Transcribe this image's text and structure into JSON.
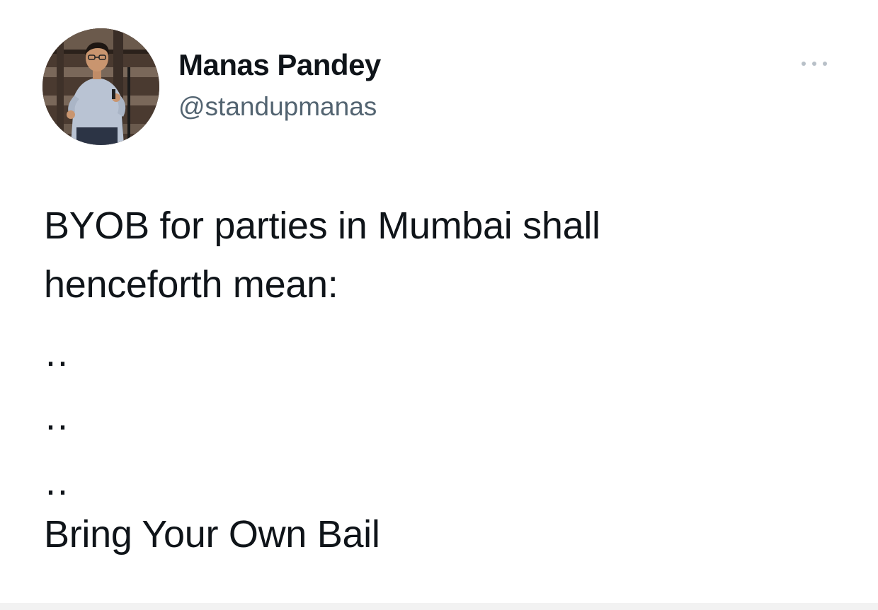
{
  "tweet": {
    "author": {
      "display_name": "Manas Pandey",
      "handle": "@standupmanas",
      "avatar": "profile-photo"
    },
    "more_icon": "more-horizontal-icon",
    "body": {
      "line1": "BYOB for parties in Mumbai shall",
      "line2": "henceforth mean:",
      "dots1": "..",
      "dots2": "..",
      "dots3": "..",
      "punchline": "Bring Your Own Bail"
    }
  }
}
